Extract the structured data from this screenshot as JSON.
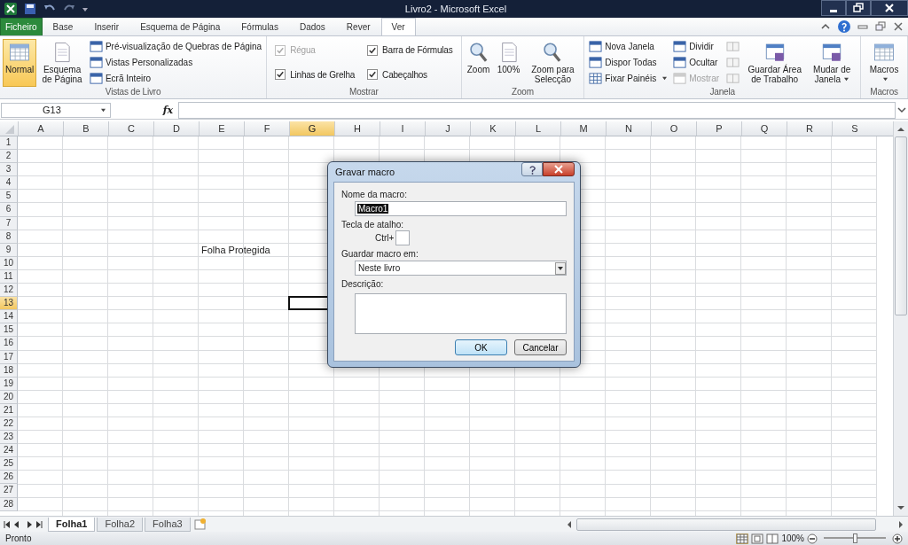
{
  "window": {
    "title": "Livro2 - Microsoft Excel"
  },
  "tabs": [
    {
      "label": "Ficheiro",
      "kind": "file",
      "selected": false
    },
    {
      "label": "Base",
      "kind": "tab",
      "selected": false
    },
    {
      "label": "Inserir",
      "kind": "tab",
      "selected": false
    },
    {
      "label": "Esquema de Página",
      "kind": "tab",
      "selected": false
    },
    {
      "label": "Fórmulas",
      "kind": "tab",
      "selected": false
    },
    {
      "label": "Dados",
      "kind": "tab",
      "selected": false
    },
    {
      "label": "Rever",
      "kind": "tab",
      "selected": false
    },
    {
      "label": "Ver",
      "kind": "tab",
      "selected": true
    }
  ],
  "ribbon": [
    {
      "label": "Vistas de Livro",
      "items": [
        {
          "kind": "large",
          "label": "Normal",
          "selected": true
        },
        {
          "kind": "large",
          "label": "Esquema de Página",
          "selected": false
        },
        {
          "kind": "small",
          "label": "Pré-visualização de Quebras de Página"
        },
        {
          "kind": "small",
          "label": "Vistas Personalizadas"
        },
        {
          "kind": "small",
          "label": "Ecrã Inteiro"
        }
      ]
    },
    {
      "label": "Mostrar",
      "items": [
        {
          "kind": "check",
          "label": "Régua",
          "checked": true,
          "disabled": true
        },
        {
          "kind": "check",
          "label": "Linhas de Grelha",
          "checked": true,
          "disabled": false
        },
        {
          "kind": "check",
          "label": "Barra de Fórmulas",
          "checked": true,
          "disabled": false
        },
        {
          "kind": "check",
          "label": "Cabeçalhos",
          "checked": true,
          "disabled": false
        }
      ]
    },
    {
      "label": "Zoom",
      "items": [
        {
          "kind": "large",
          "label": "Zoom"
        },
        {
          "kind": "large",
          "label": "100%"
        },
        {
          "kind": "large",
          "label": "Zoom para Selecção"
        }
      ]
    },
    {
      "label": "Janela",
      "items": [
        {
          "kind": "small",
          "label": "Nova Janela"
        },
        {
          "kind": "small",
          "label": "Dispor Todas"
        },
        {
          "kind": "small",
          "label": "Fixar Painéis",
          "dropdown": true
        },
        {
          "kind": "small",
          "label": "Dividir"
        },
        {
          "kind": "small",
          "label": "Ocultar"
        },
        {
          "kind": "small",
          "label": "Mostrar",
          "disabled": true
        },
        {
          "kind": "icon",
          "disabled": true
        },
        {
          "kind": "icon",
          "disabled": true
        },
        {
          "kind": "icon",
          "disabled": true
        },
        {
          "kind": "large",
          "label": "Guardar Área de Trabalho"
        },
        {
          "kind": "large",
          "label": "Mudar de Janela",
          "dropdown": true
        }
      ]
    },
    {
      "label": "Macros",
      "items": [
        {
          "kind": "large",
          "label": "Macros",
          "dropdown": true
        }
      ]
    }
  ],
  "formula_bar": {
    "name_box": "G13",
    "function_label": "fx"
  },
  "columns": [
    {
      "label": "A",
      "selected": false
    },
    {
      "label": "B",
      "selected": false
    },
    {
      "label": "C",
      "selected": false
    },
    {
      "label": "D",
      "selected": false
    },
    {
      "label": "E",
      "selected": false
    },
    {
      "label": "F",
      "selected": false
    },
    {
      "label": "G",
      "selected": true
    },
    {
      "label": "H",
      "selected": false
    },
    {
      "label": "I",
      "selected": false
    },
    {
      "label": "J",
      "selected": false
    },
    {
      "label": "K",
      "selected": false
    },
    {
      "label": "L",
      "selected": false
    },
    {
      "label": "M",
      "selected": false
    },
    {
      "label": "N",
      "selected": false
    },
    {
      "label": "O",
      "selected": false
    },
    {
      "label": "P",
      "selected": false
    },
    {
      "label": "Q",
      "selected": false
    },
    {
      "label": "R",
      "selected": false
    },
    {
      "label": "S",
      "selected": false
    }
  ],
  "rows": [
    {
      "label": "1",
      "selected": false
    },
    {
      "label": "2",
      "selected": false
    },
    {
      "label": "3",
      "selected": false
    },
    {
      "label": "4",
      "selected": false
    },
    {
      "label": "5",
      "selected": false
    },
    {
      "label": "6",
      "selected": false
    },
    {
      "label": "7",
      "selected": false
    },
    {
      "label": "8",
      "selected": false
    },
    {
      "label": "9",
      "selected": false,
      "cells": [
        null,
        null,
        null,
        null,
        "Folha Protegida"
      ]
    },
    {
      "label": "10",
      "selected": false
    },
    {
      "label": "11",
      "selected": false
    },
    {
      "label": "12",
      "selected": false
    },
    {
      "label": "13",
      "selected": true
    },
    {
      "label": "14",
      "selected": false
    },
    {
      "label": "15",
      "selected": false
    },
    {
      "label": "16",
      "selected": false
    },
    {
      "label": "17",
      "selected": false
    },
    {
      "label": "18",
      "selected": false
    },
    {
      "label": "19",
      "selected": false
    },
    {
      "label": "20",
      "selected": false
    },
    {
      "label": "21",
      "selected": false
    },
    {
      "label": "22",
      "selected": false
    },
    {
      "label": "23",
      "selected": false
    },
    {
      "label": "24",
      "selected": false
    },
    {
      "label": "25",
      "selected": false
    },
    {
      "label": "26",
      "selected": false
    },
    {
      "label": "27",
      "selected": false
    },
    {
      "label": "28",
      "selected": false
    }
  ],
  "sheet_tabs": [
    {
      "label": "Folha1",
      "selected": true
    },
    {
      "label": "Folha2",
      "selected": false
    },
    {
      "label": "Folha3",
      "selected": false
    }
  ],
  "status_bar": {
    "text": "Pronto",
    "zoom": "100%",
    "zoom_level": {
      "level": 0.5
    }
  },
  "dialog": {
    "title": "Gravar macro",
    "name_label": "Nome da macro:",
    "name_value": "Macro1",
    "shortcut_label": "Tecla de atalho:",
    "shortcut_prefix": "Ctrl+",
    "store_label": "Guardar macro em:",
    "store_value": "Neste livro",
    "description_label": "Descrição:",
    "buttons": [
      {
        "label": "OK",
        "kind": "default"
      },
      {
        "label": "Cancelar",
        "kind": "normal"
      }
    ]
  }
}
